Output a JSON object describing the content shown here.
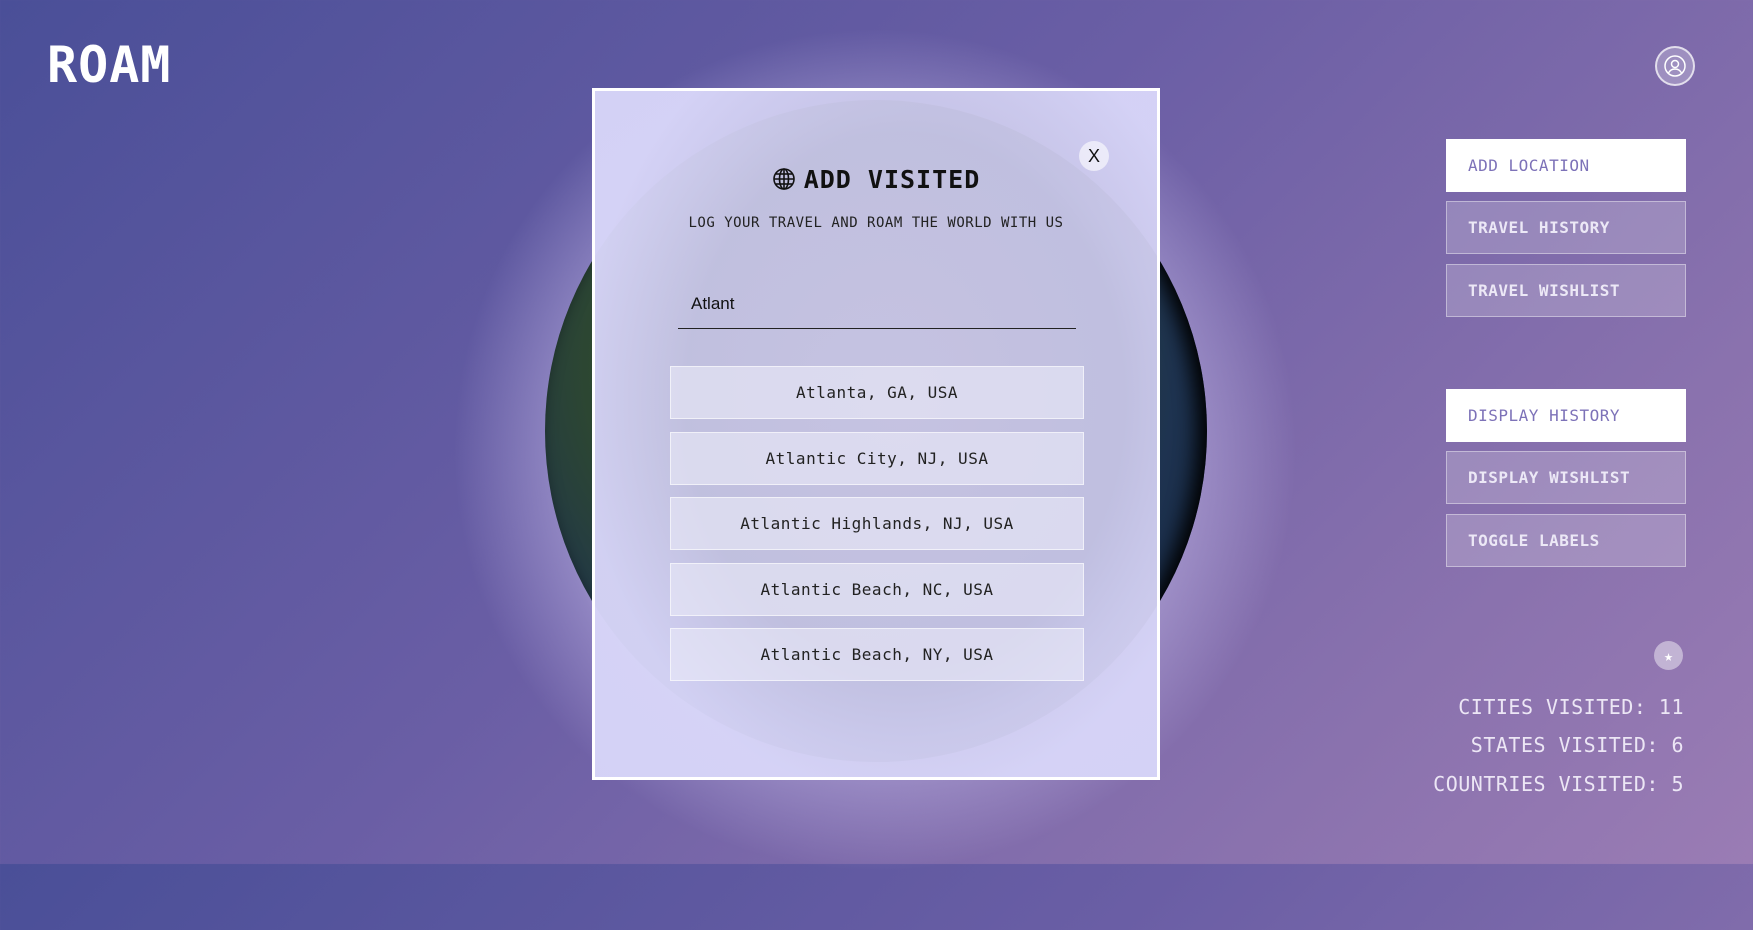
{
  "app": {
    "logo": "ROAM"
  },
  "sidebar": {
    "buttons": [
      {
        "label": "ADD LOCATION"
      },
      {
        "label": "TRAVEL HISTORY"
      },
      {
        "label": "TRAVEL WISHLIST"
      }
    ],
    "display_buttons": [
      {
        "label": "DISPLAY HISTORY"
      },
      {
        "label": "DISPLAY WISHLIST"
      },
      {
        "label": "TOGGLE LABELS"
      }
    ]
  },
  "stats": {
    "cities": "CITIES VISITED: 11",
    "states": "STATES VISITED: 6",
    "countries": "COUNTRIES VISITED: 5"
  },
  "modal": {
    "close_label": "X",
    "title": "ADD VISITED",
    "subtitle": "LOG YOUR TRAVEL AND ROAM THE WORLD WITH US",
    "search_value": "Atlant",
    "results": [
      "Atlanta, GA, USA",
      "Atlantic City, NJ, USA",
      "Atlantic Highlands, NJ, USA",
      "Atlantic Beach, NC, USA",
      "Atlantic Beach, NY, USA"
    ]
  }
}
